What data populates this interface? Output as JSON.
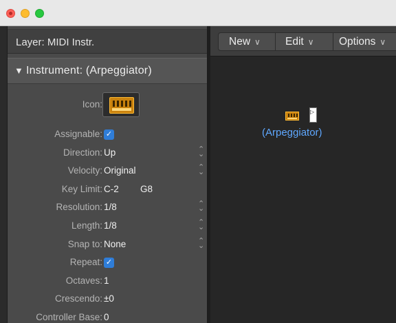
{
  "window": {
    "controls": [
      "close",
      "minimize",
      "zoom"
    ]
  },
  "inspector": {
    "layer_label": "Layer: MIDI Instr.",
    "instrument_header": "Instrument:  (Arpeggiator)",
    "icon_label": "Icon:",
    "rows": [
      {
        "label": "Assignable:",
        "type": "checkbox",
        "checked": true
      },
      {
        "label": "Direction:",
        "value": "Up",
        "stepper": true
      },
      {
        "label": "Velocity:",
        "value": "Original",
        "stepper": true
      },
      {
        "label": "Key Limit:",
        "value": "C-2",
        "value2": "G8"
      },
      {
        "label": "Resolution:",
        "value": "1/8",
        "stepper": true
      },
      {
        "label": "Length:",
        "value": "1/8",
        "stepper": true
      },
      {
        "label": "Snap to:",
        "value": "None",
        "stepper": true
      },
      {
        "label": "Repeat:",
        "type": "checkbox",
        "checked": true
      },
      {
        "label": "Octaves:",
        "value": "1"
      },
      {
        "label": "Crescendo:",
        "value": "±0"
      },
      {
        "label": "Controller Base:",
        "value": "0"
      }
    ]
  },
  "toolbar": {
    "new_label": "New",
    "edit_label": "Edit",
    "options_label": "Options",
    "chevron": "∨"
  },
  "canvas": {
    "node_label": "(Arpeggiator)",
    "node_icon": "keyboard-icon",
    "output_glyph": "▷"
  },
  "colors": {
    "accent": "#2f7dd8",
    "node_label": "#5fa8ff",
    "icon_orange": "#c9820e"
  }
}
